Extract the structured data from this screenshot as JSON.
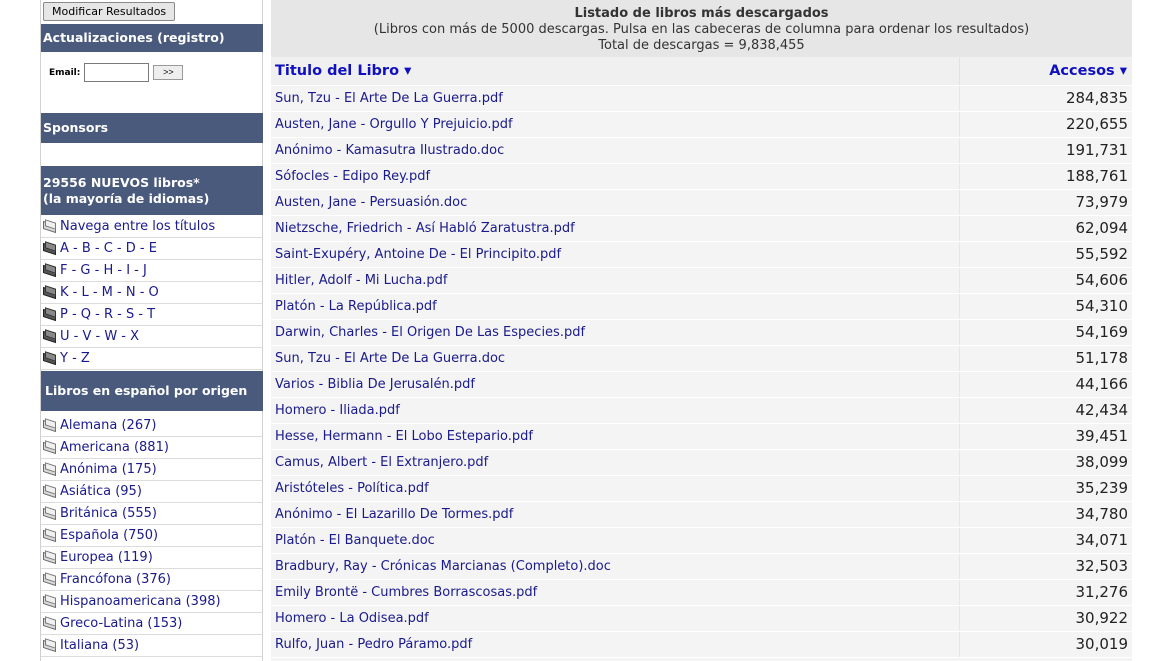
{
  "sidebar": {
    "modify_button": "Modificar Resultados",
    "updates_header": "Actualizaciones (registro)",
    "email_label": "Email:",
    "email_value": "",
    "email_go": ">>",
    "sponsors_header": "Sponsors",
    "new_books_header_1": "29556 NUEVOS  libros*",
    "new_books_header_2": "(la mayoría de idiomas)",
    "title_links": [
      {
        "label": "Navega entre los títulos",
        "icon": "book-icon"
      },
      {
        "label": "A - B - C - D - E",
        "icon": "book-dark-icon"
      },
      {
        "label": "F - G - H - I - J",
        "icon": "book-dark-icon"
      },
      {
        "label": "K - L - M - N - O",
        "icon": "book-dark-icon"
      },
      {
        "label": "P - Q - R - S - T",
        "icon": "book-dark-icon"
      },
      {
        "label": "U - V - W - X",
        "icon": "book-dark-icon"
      },
      {
        "label": "Y - Z",
        "icon": "book-dark-icon"
      }
    ],
    "origin_header": "Libros en español por origen",
    "origin_links": [
      {
        "label": "Alemana (267)"
      },
      {
        "label": "Americana (881)"
      },
      {
        "label": "Anónima (175)"
      },
      {
        "label": "Asiática (95)"
      },
      {
        "label": "Británica (555)"
      },
      {
        "label": "Española (750)"
      },
      {
        "label": "Europea (119)"
      },
      {
        "label": "Francófona (376)"
      },
      {
        "label": "Hispanoamericana (398)"
      },
      {
        "label": "Greco-Latina (153)"
      },
      {
        "label": "Italiana (53)"
      }
    ]
  },
  "main": {
    "title": "Listado de libros más descargados",
    "subtitle": "(Libros con más de 5000 descargas. Pulsa en las cabeceras de columna para ordenar los resultados)",
    "total": "Total de descargas = 9,838,455",
    "col_title": "Titulo del Libro ▾",
    "col_access": "Accesos ▾",
    "rows": [
      {
        "title": "Sun, Tzu - El Arte De La Guerra.pdf",
        "count": "284,835"
      },
      {
        "title": "Austen, Jane - Orgullo Y Prejuicio.pdf",
        "count": "220,655"
      },
      {
        "title": "Anónimo - Kamasutra Ilustrado.doc",
        "count": "191,731"
      },
      {
        "title": "Sófocles - Edipo Rey.pdf",
        "count": "188,761"
      },
      {
        "title": "Austen, Jane - Persuasión.doc",
        "count": "73,979"
      },
      {
        "title": "Nietzsche, Friedrich - Así Habló Zaratustra.pdf",
        "count": "62,094"
      },
      {
        "title": "Saint-Exupéry, Antoine De - El Principito.pdf",
        "count": "55,592"
      },
      {
        "title": "Hitler, Adolf - Mi Lucha.pdf",
        "count": "54,606"
      },
      {
        "title": "Platón - La República.pdf",
        "count": "54,310"
      },
      {
        "title": "Darwin, Charles - El Origen De Las Especies.pdf",
        "count": "54,169"
      },
      {
        "title": "Sun, Tzu - El Arte De La Guerra.doc",
        "count": "51,178"
      },
      {
        "title": "Varios - Biblia De Jerusalén.pdf",
        "count": "44,166"
      },
      {
        "title": "Homero - Iliada.pdf",
        "count": "42,434"
      },
      {
        "title": "Hesse, Hermann - El Lobo Estepario.pdf",
        "count": "39,451"
      },
      {
        "title": "Camus, Albert - El Extranjero.pdf",
        "count": "38,099"
      },
      {
        "title": "Aristóteles - Política.pdf",
        "count": "35,239"
      },
      {
        "title": "Anónimo - El Lazarillo De Tormes.pdf",
        "count": "34,780"
      },
      {
        "title": "Platón - El Banquete.doc",
        "count": "34,071"
      },
      {
        "title": "Bradbury, Ray - Crónicas Marcianas (Completo).doc",
        "count": "32,503"
      },
      {
        "title": "Emily Brontë - Cumbres Borrascosas.pdf",
        "count": "31,276"
      },
      {
        "title": "Homero - La Odisea.pdf",
        "count": "30,922"
      },
      {
        "title": "Rulfo, Juan - Pedro Páramo.pdf",
        "count": "30,019"
      }
    ]
  },
  "colors": {
    "header_bg": "#4a5a7c",
    "link": "#1a1a8c",
    "column_header": "#1010c0"
  }
}
